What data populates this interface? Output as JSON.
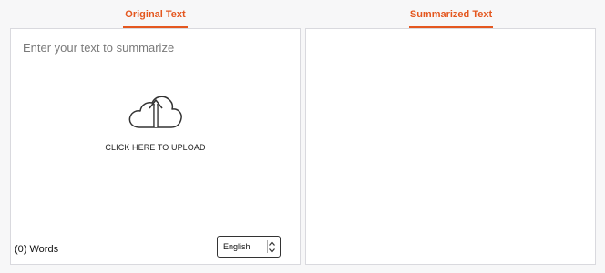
{
  "tabs": {
    "original": "Original Text",
    "summary": "Summarized Text"
  },
  "input": {
    "placeholder": "Enter your text to summarize",
    "upload_label": "CLICK HERE TO UPLOAD",
    "upload_icon": "cloud-upload-icon",
    "word_count": "(0) Words"
  },
  "language": {
    "selected": "English"
  },
  "colors": {
    "accent": "#e4571f",
    "panel_border": "#d9d9de",
    "background": "#f7f7f8"
  }
}
